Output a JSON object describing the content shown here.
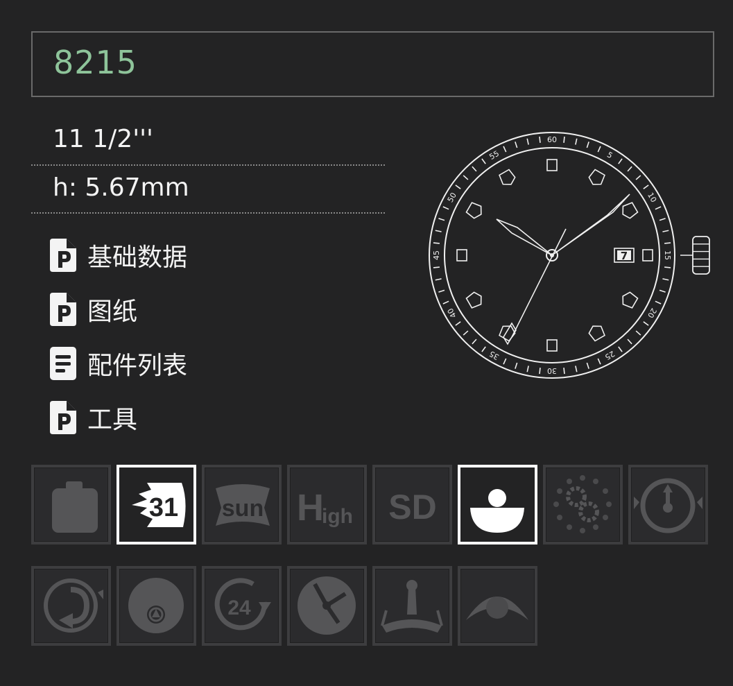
{
  "search": {
    "value": "8215"
  },
  "specs": {
    "size": "11 1/2'''",
    "height": "h: 5.67mm"
  },
  "documents": [
    {
      "label": "基础数据",
      "icon": "pdf-icon"
    },
    {
      "label": "图纸",
      "icon": "pdf-icon"
    },
    {
      "label": "配件列表",
      "icon": "document-list-icon"
    },
    {
      "label": "工具",
      "icon": "pdf-icon"
    }
  ],
  "dial": {
    "bezel_numbers": [
      "60",
      "5",
      "10",
      "15",
      "20",
      "25",
      "30",
      "35",
      "40",
      "45",
      "50",
      "55"
    ],
    "date_window": "7"
  },
  "function_icons": [
    {
      "name": "blank-function-icon",
      "active": false
    },
    {
      "name": "date-31-icon",
      "text": "31",
      "active": true
    },
    {
      "name": "sun-icon",
      "text": "sun",
      "active": false
    },
    {
      "name": "high-beat-icon",
      "text": "High",
      "text2": "igh",
      "active": false
    },
    {
      "name": "sd-icon",
      "text": "SD",
      "active": false
    },
    {
      "name": "automatic-rotor-icon",
      "active": true
    },
    {
      "name": "gear-mechanism-icon",
      "active": false
    },
    {
      "name": "chronograph-icon",
      "active": false
    },
    {
      "name": "rotating-bezel-icon",
      "active": false
    },
    {
      "name": "small-seconds-icon",
      "active": false
    },
    {
      "name": "24-hour-icon",
      "text": "24",
      "active": false
    },
    {
      "name": "gmt-hands-icon",
      "active": false
    },
    {
      "name": "pendulum-icon",
      "active": false
    },
    {
      "name": "moon-phase-icon",
      "active": false
    }
  ],
  "colors": {
    "accent": "#8ec49a",
    "background": "#232324",
    "inactive_icon": "#5a5a5c",
    "active_border": "#ffffff"
  }
}
